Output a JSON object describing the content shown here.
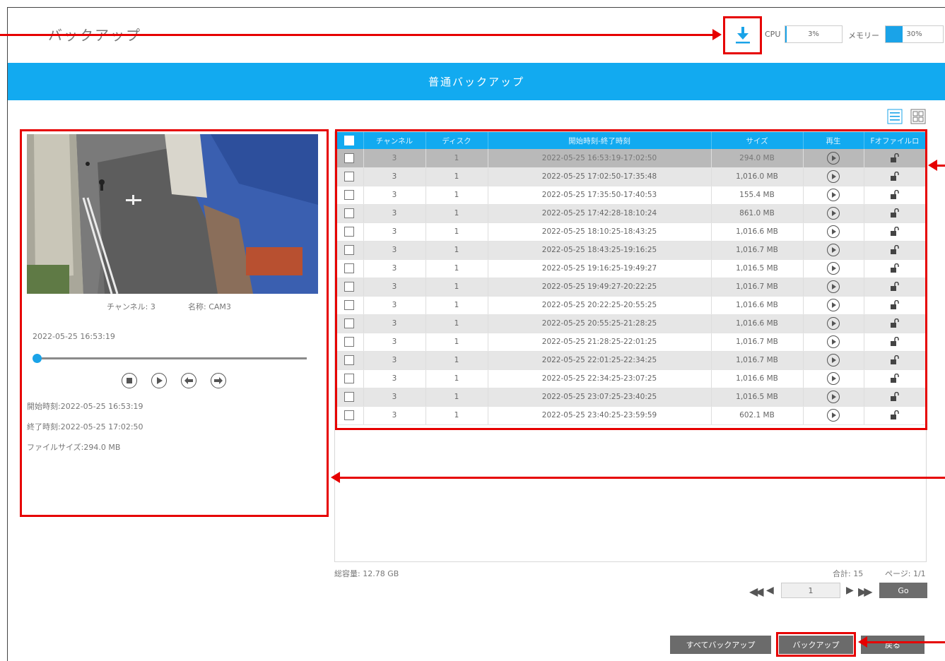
{
  "header": {
    "title": "バックアップ",
    "cpu_label": "CPU",
    "cpu_value": "3%",
    "cpu_fraction": 0.03,
    "memory_label": "メモリー",
    "memory_value": "30%",
    "memory_fraction": 0.3
  },
  "banner": {
    "title": "普通バックアップ"
  },
  "preview": {
    "channel_label": "チャンネル: 3",
    "name_label": "名称: CAM3",
    "current_time": "2022-05-25 16:53:19",
    "slider_position": 0.0,
    "start_time": "開始時刻:2022-05-25 16:53:19",
    "end_time": "終了時刻:2022-05-25 17:02:50",
    "file_size": "ファイルサイズ:294.0 MB"
  },
  "table": {
    "headers": {
      "channel": "チャンネル",
      "disk": "ディスク",
      "time": "開始時刻-終了時刻",
      "size": "サイズ",
      "play": "再生",
      "lock": "Fオファイルロ"
    },
    "rows": [
      {
        "channel": "3",
        "disk": "1",
        "time": "2022-05-25 16:53:19-17:02:50",
        "size": "294.0 MB"
      },
      {
        "channel": "3",
        "disk": "1",
        "time": "2022-05-25 17:02:50-17:35:48",
        "size": "1,016.0 MB"
      },
      {
        "channel": "3",
        "disk": "1",
        "time": "2022-05-25 17:35:50-17:40:53",
        "size": "155.4 MB"
      },
      {
        "channel": "3",
        "disk": "1",
        "time": "2022-05-25 17:42:28-18:10:24",
        "size": "861.0 MB"
      },
      {
        "channel": "3",
        "disk": "1",
        "time": "2022-05-25 18:10:25-18:43:25",
        "size": "1,016.6 MB"
      },
      {
        "channel": "3",
        "disk": "1",
        "time": "2022-05-25 18:43:25-19:16:25",
        "size": "1,016.7 MB"
      },
      {
        "channel": "3",
        "disk": "1",
        "time": "2022-05-25 19:16:25-19:49:27",
        "size": "1,016.5 MB"
      },
      {
        "channel": "3",
        "disk": "1",
        "time": "2022-05-25 19:49:27-20:22:25",
        "size": "1,016.7 MB"
      },
      {
        "channel": "3",
        "disk": "1",
        "time": "2022-05-25 20:22:25-20:55:25",
        "size": "1,016.6 MB"
      },
      {
        "channel": "3",
        "disk": "1",
        "time": "2022-05-25 20:55:25-21:28:25",
        "size": "1,016.6 MB"
      },
      {
        "channel": "3",
        "disk": "1",
        "time": "2022-05-25 21:28:25-22:01:25",
        "size": "1,016.7 MB"
      },
      {
        "channel": "3",
        "disk": "1",
        "time": "2022-05-25 22:01:25-22:34:25",
        "size": "1,016.7 MB"
      },
      {
        "channel": "3",
        "disk": "1",
        "time": "2022-05-25 22:34:25-23:07:25",
        "size": "1,016.6 MB"
      },
      {
        "channel": "3",
        "disk": "1",
        "time": "2022-05-25 23:07:25-23:40:25",
        "size": "1,016.5 MB"
      },
      {
        "channel": "3",
        "disk": "1",
        "time": "2022-05-25 23:40:25-23:59:59",
        "size": "602.1 MB"
      }
    ]
  },
  "footer": {
    "total_capacity": "総容量: 12.78 GB",
    "total_count": "合計: 15",
    "page_info": "ページ: 1/1",
    "page_input": "1",
    "go_label": "Go"
  },
  "buttons": {
    "backup_all": "すべてバックアップ",
    "backup": "バックアップ",
    "back": "戻る"
  },
  "colors": {
    "accent": "#12aaf0",
    "annotation": "#e60000",
    "button": "#6b6b6b"
  }
}
